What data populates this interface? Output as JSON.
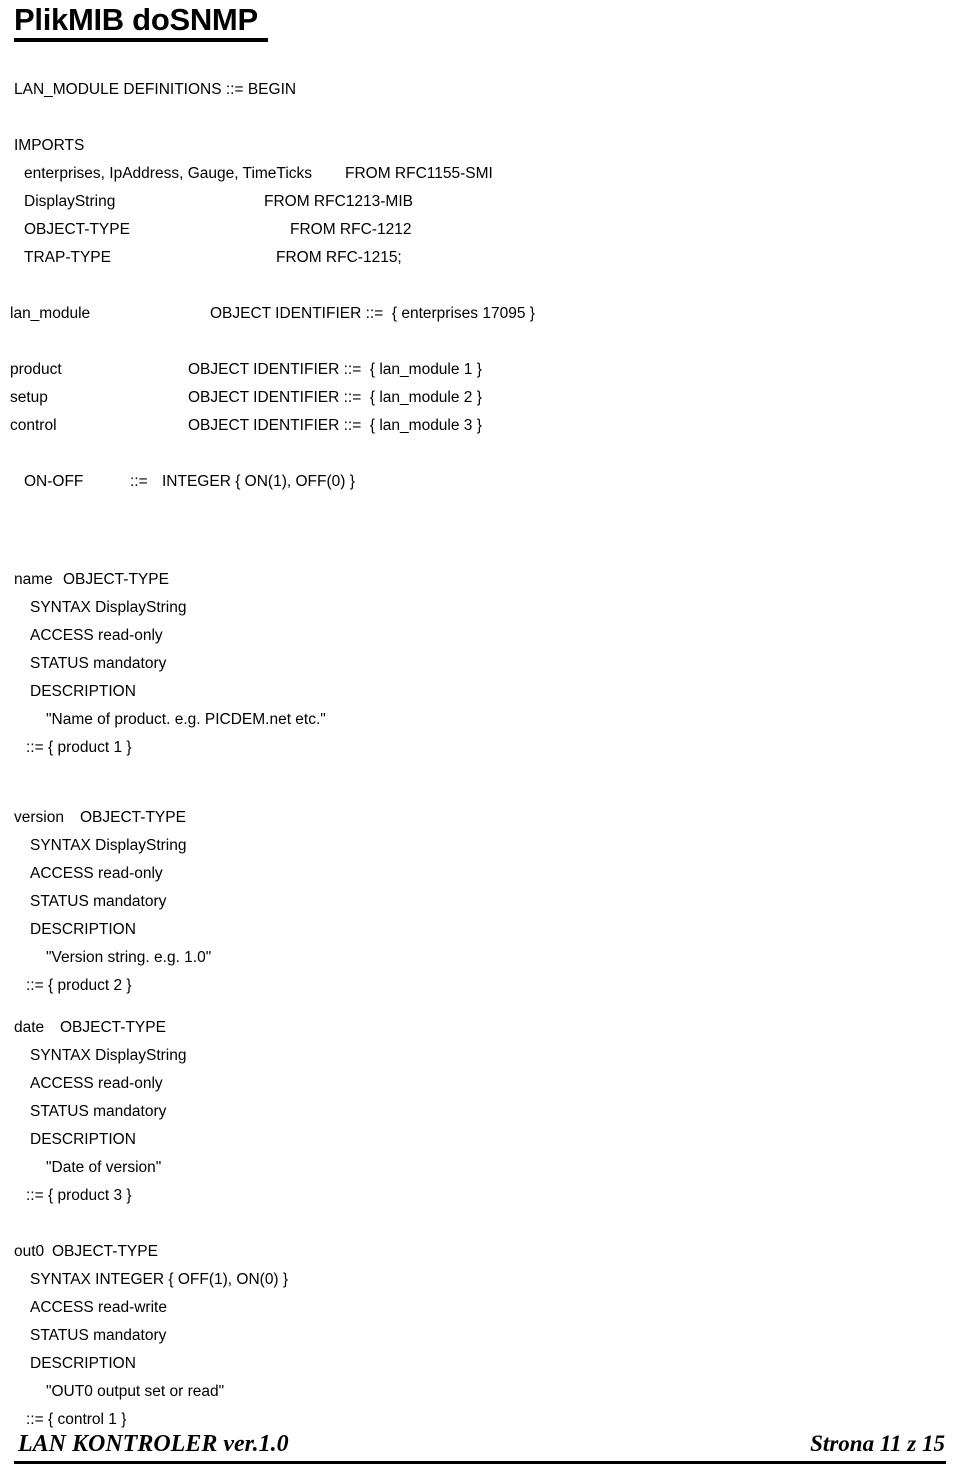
{
  "document": {
    "title": "PlikMIB doSNMP",
    "module_header": "LAN_MODULE DEFINITIONS ::= BEGIN",
    "imports": {
      "keyword": "IMPORTS",
      "entries": [
        {
          "symbols": "enterprises, IpAddress, Gauge, TimeTicks",
          "from": "FROM RFC1155-SMI"
        },
        {
          "symbols": "DisplayString",
          "from": "FROM RFC1213-MIB"
        },
        {
          "symbols": "OBJECT-TYPE",
          "from": "FROM RFC-1212"
        },
        {
          "symbols": "TRAP-TYPE",
          "from": "FROM RFC-1215;"
        }
      ]
    },
    "oid_root": {
      "label": "lan_module",
      "definition": "OBJECT IDENTIFIER ::=  { enterprises 17095 }"
    },
    "oid_children": [
      {
        "label": "product",
        "definition": "OBJECT IDENTIFIER ::=  { lan_module 1 }"
      },
      {
        "label": "setup",
        "definition": "OBJECT IDENTIFIER ::=  { lan_module 2 }"
      },
      {
        "label": "control",
        "definition": "OBJECT IDENTIFIER ::=  { lan_module 3 }"
      }
    ],
    "textual_convention": {
      "name": "ON-OFF",
      "assign": "::=",
      "value": "INTEGER { ON(1), OFF(0) }"
    },
    "objects": [
      {
        "name": "name",
        "type_keyword": "OBJECT-TYPE",
        "syntax": "SYNTAX DisplayString",
        "access": "ACCESS read-only",
        "status": "STATUS mandatory",
        "description_keyword": "DESCRIPTION",
        "description": "\"Name of product. e.g. PICDEM.net etc.\"",
        "oid": "::= { product 1 }"
      },
      {
        "name": "version",
        "type_keyword": "OBJECT-TYPE",
        "syntax": "SYNTAX DisplayString",
        "access": "ACCESS read-only",
        "status": "STATUS mandatory",
        "description_keyword": "DESCRIPTION",
        "description": "\"Version string. e.g. 1.0\"",
        "oid": "::= { product 2 }"
      },
      {
        "name": "date",
        "type_keyword": "OBJECT-TYPE",
        "syntax": "SYNTAX DisplayString",
        "access": "ACCESS read-only",
        "status": "STATUS mandatory",
        "description_keyword": "DESCRIPTION",
        "description": "\"Date of version\"",
        "oid": "::= { product 3 }"
      },
      {
        "name": "out0",
        "type_keyword": "OBJECT-TYPE",
        "syntax": "SYNTAX INTEGER { OFF(1), ON(0) }",
        "access": "ACCESS read-write",
        "status": "STATUS mandatory",
        "description_keyword": "DESCRIPTION",
        "description": "\"OUT0 output set or read\"",
        "oid": "::= { control 1 }"
      }
    ]
  },
  "footer": {
    "left": "LAN KONTROLER  ver.1.0",
    "right": "Strona 11 z 15"
  }
}
